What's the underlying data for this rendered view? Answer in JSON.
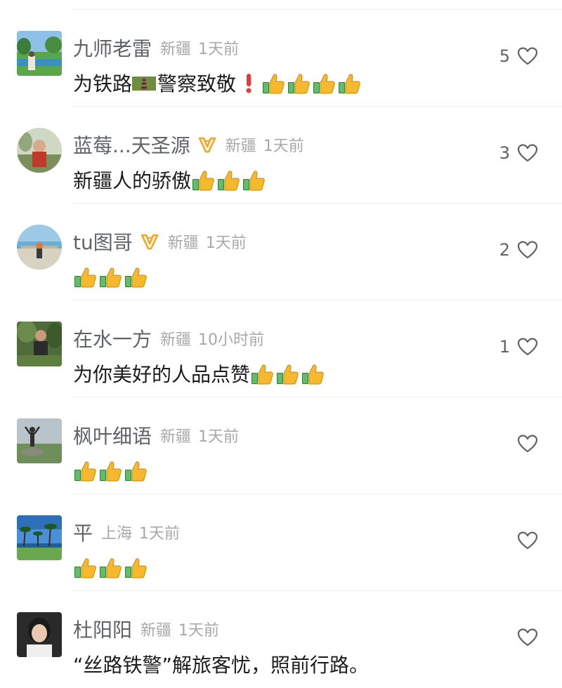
{
  "comments": [
    {
      "username": "九师老雷",
      "verified": false,
      "location": "新疆",
      "time": "1天前",
      "text": "为铁路",
      "text_suffix": "警察致敬",
      "inline_icons": [
        "railway-track-icon",
        "exclamation-icon"
      ],
      "emojis": [
        "thumbs-up-icon",
        "thumbs-up-icon",
        "thumbs-up-icon",
        "thumbs-up-icon"
      ],
      "likes": "5",
      "avatar": "landscape-lake-avatar"
    },
    {
      "username": "蓝莓...天圣源",
      "verified": true,
      "location": "新疆",
      "time": "1天前",
      "text": "新疆人的骄傲",
      "emojis": [
        "thumbs-up-icon",
        "thumbs-up-icon",
        "thumbs-up-icon"
      ],
      "likes": "3",
      "avatar": "person-portrait-avatar"
    },
    {
      "username": "tu图哥",
      "verified": true,
      "location": "新疆",
      "time": "1天前",
      "text": "",
      "emojis": [
        "thumbs-up-icon",
        "thumbs-up-icon",
        "thumbs-up-icon"
      ],
      "likes": "2",
      "avatar": "sky-person-avatar"
    },
    {
      "username": "在水一方",
      "verified": false,
      "location": "新疆",
      "time": "10小时前",
      "text": "为你美好的人品点赞",
      "emojis": [
        "thumbs-up-icon",
        "thumbs-up-icon",
        "thumbs-up-icon"
      ],
      "likes": "1",
      "avatar": "garden-person-avatar"
    },
    {
      "username": "枫叶细语",
      "verified": false,
      "location": "新疆",
      "time": "1天前",
      "text": "",
      "emojis": [
        "thumbs-up-icon",
        "thumbs-up-icon",
        "thumbs-up-icon"
      ],
      "likes": "",
      "avatar": "mountain-person-avatar"
    },
    {
      "username": "平",
      "verified": false,
      "location": "上海",
      "time": "1天前",
      "text": "",
      "emojis": [
        "thumbs-up-icon",
        "thumbs-up-icon",
        "thumbs-up-icon"
      ],
      "likes": "",
      "avatar": "palm-beach-avatar"
    },
    {
      "username": "杜阳阳",
      "verified": false,
      "location": "新疆",
      "time": "1天前",
      "text": "“丝路铁警”解旅客忧，照前行路。",
      "emojis": [],
      "likes": "",
      "avatar": "young-person-avatar"
    }
  ],
  "colors": {
    "username": "#5f6368",
    "meta": "#a8a8a8",
    "text": "#1c1c1c",
    "badge": "#f5a623",
    "divider": "#ececec"
  }
}
